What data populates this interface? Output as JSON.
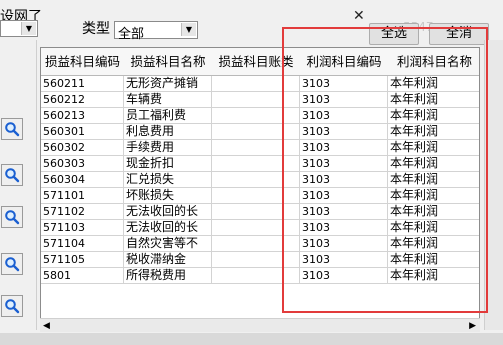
{
  "header": {
    "partial_text": "设网了",
    "left_select_value": "",
    "type_label": "类型",
    "type_value": "全部",
    "faint_text": "5547",
    "select_all_label": "全选",
    "clear_all_label": "全消"
  },
  "grid": {
    "columns": [
      "损益科目编码",
      "损益科目名称",
      "损益科目账类",
      "利润科目编码",
      "利润科目名称"
    ],
    "rows": [
      {
        "code": "560211",
        "name": "无形资产摊销",
        "account_type": "",
        "profit_code": "3103",
        "profit_name": "本年利润"
      },
      {
        "code": "560212",
        "name": "车辆费",
        "account_type": "",
        "profit_code": "3103",
        "profit_name": "本年利润"
      },
      {
        "code": "560213",
        "name": "员工福利费",
        "account_type": "",
        "profit_code": "3103",
        "profit_name": "本年利润"
      },
      {
        "code": "560301",
        "name": "利息费用",
        "account_type": "",
        "profit_code": "3103",
        "profit_name": "本年利润"
      },
      {
        "code": "560302",
        "name": "手续费用",
        "account_type": "",
        "profit_code": "3103",
        "profit_name": "本年利润"
      },
      {
        "code": "560303",
        "name": "现金折扣",
        "account_type": "",
        "profit_code": "3103",
        "profit_name": "本年利润"
      },
      {
        "code": "560304",
        "name": "汇兑损失",
        "account_type": "",
        "profit_code": "3103",
        "profit_name": "本年利润"
      },
      {
        "code": "571101",
        "name": "坏账损失",
        "account_type": "",
        "profit_code": "3103",
        "profit_name": "本年利润"
      },
      {
        "code": "571102",
        "name": "无法收回的长",
        "account_type": "",
        "profit_code": "3103",
        "profit_name": "本年利润"
      },
      {
        "code": "571103",
        "name": "无法收回的长",
        "account_type": "",
        "profit_code": "3103",
        "profit_name": "本年利润"
      },
      {
        "code": "571104",
        "name": "自然灾害等不",
        "account_type": "",
        "profit_code": "3103",
        "profit_name": "本年利润"
      },
      {
        "code": "571105",
        "name": "税收滞纳金",
        "account_type": "",
        "profit_code": "3103",
        "profit_name": "本年利润"
      },
      {
        "code": "5801",
        "name": "所得税费用",
        "account_type": "",
        "profit_code": "3103",
        "profit_name": "本年利润"
      }
    ]
  },
  "icons": {
    "search": "search-icon",
    "close": "close-icon",
    "dropdown": "chevron-down-icon",
    "scroll_left": "scroll-left-icon",
    "scroll_right": "scroll-right-icon"
  },
  "colors": {
    "highlight_border": "#e23b3b",
    "search_icon": "#1a5fd1"
  }
}
